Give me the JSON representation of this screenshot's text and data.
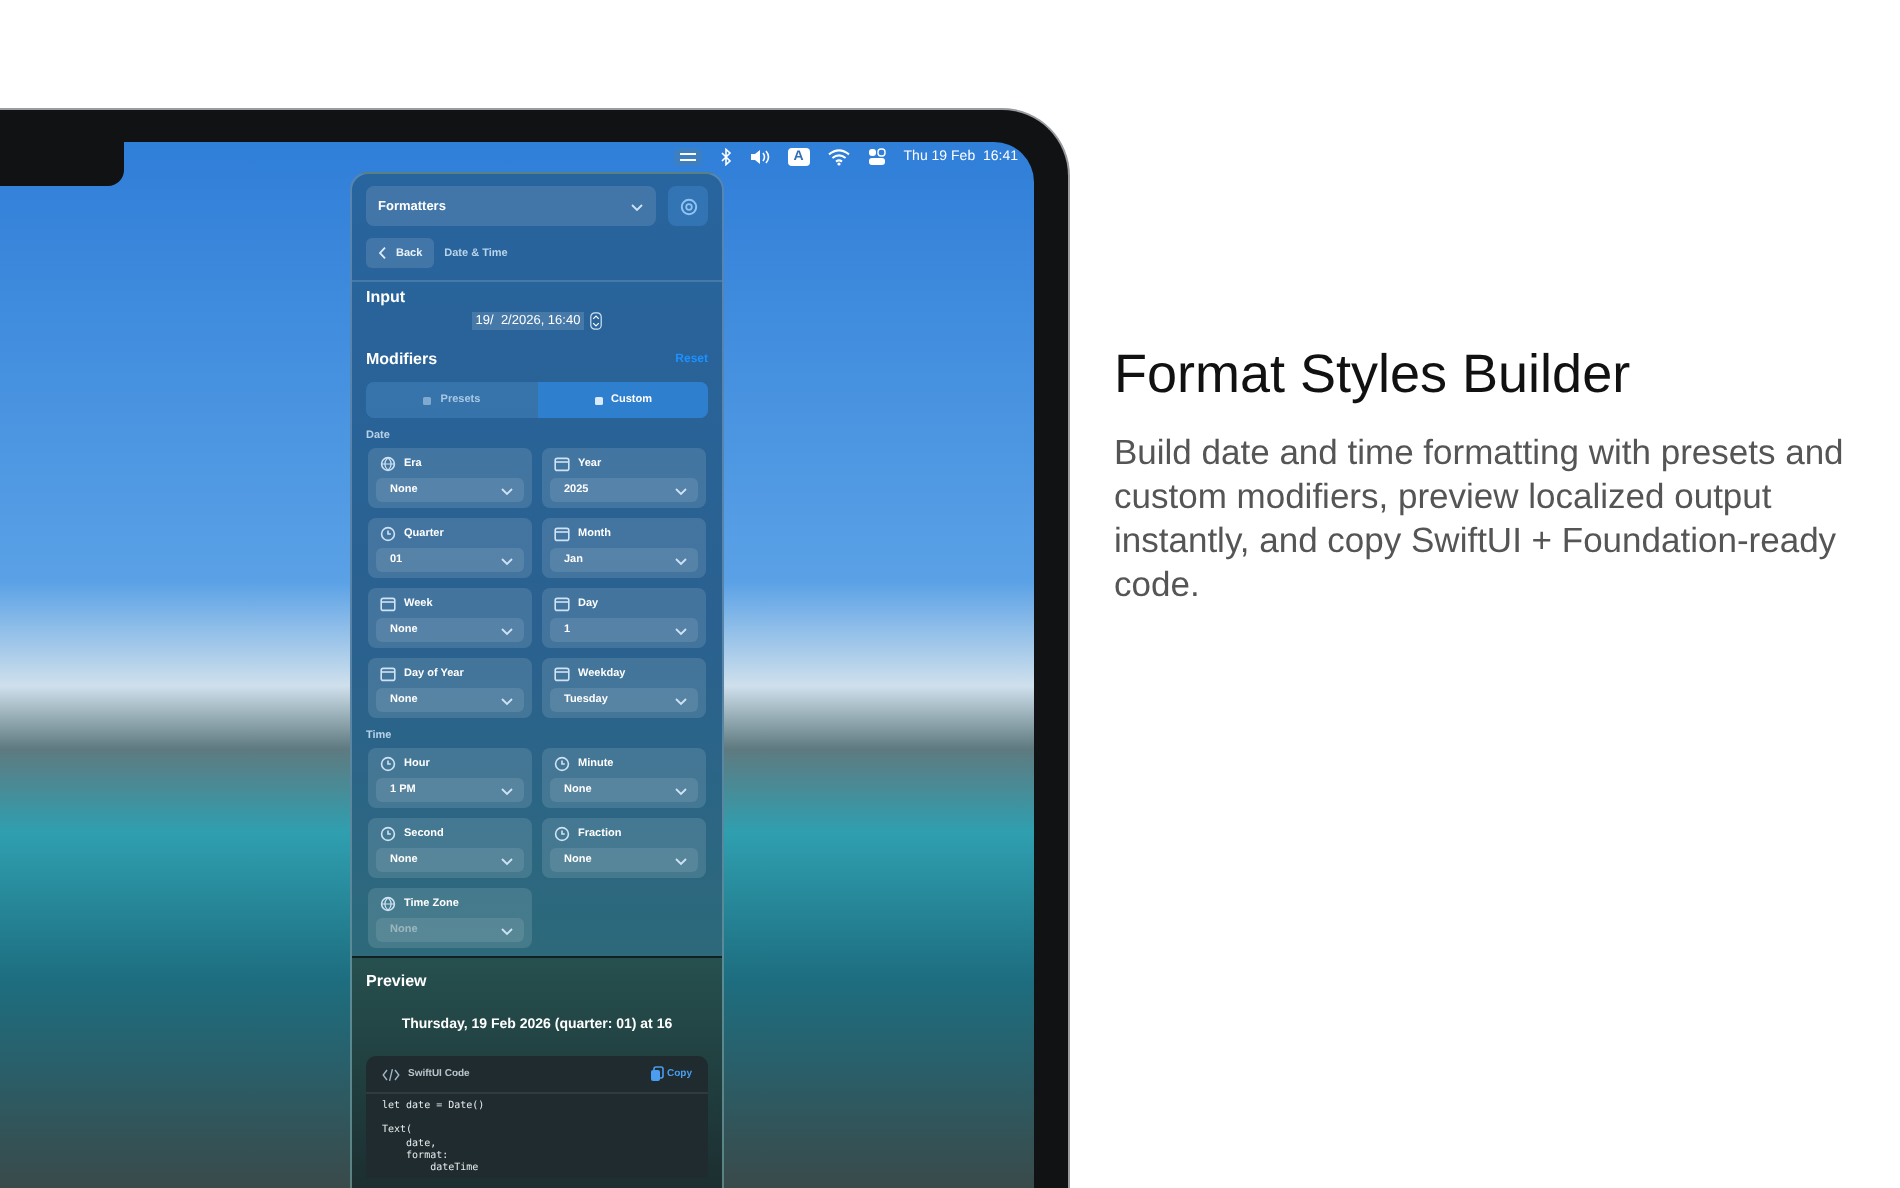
{
  "menu_bar": {
    "input_source": "A",
    "clock": "Thu 19 Feb  16:41"
  },
  "panel": {
    "picker": {
      "value": "Formatters"
    },
    "back_button": "Back",
    "breadcrumb": "Date & Time",
    "input": {
      "title": "Input",
      "value": "19/  2/2026, 16:40"
    },
    "modifiers": {
      "title": "Modifiers",
      "reset": "Reset",
      "segments": [
        {
          "label": "Presets",
          "selected": false
        },
        {
          "label": "Custom",
          "selected": true
        }
      ]
    },
    "groups": [
      {
        "title": "Date",
        "fields": [
          {
            "kind": "globe",
            "label": "Era",
            "value": "None",
            "disabled": false
          },
          {
            "kind": "calendar",
            "label": "Year",
            "value": "2025",
            "disabled": false
          },
          {
            "kind": "clock",
            "label": "Quarter",
            "value": "01",
            "disabled": false
          },
          {
            "kind": "calendar",
            "label": "Month",
            "value": "Jan",
            "disabled": false
          },
          {
            "kind": "calendar",
            "label": "Week",
            "value": "None",
            "disabled": false
          },
          {
            "kind": "calendar",
            "label": "Day",
            "value": "1",
            "disabled": false
          },
          {
            "kind": "calendar",
            "label": "Day of Year",
            "value": "None",
            "disabled": false
          },
          {
            "kind": "calendar",
            "label": "Weekday",
            "value": "Tuesday",
            "disabled": false
          }
        ]
      },
      {
        "title": "Time",
        "fields": [
          {
            "kind": "clock",
            "label": "Hour",
            "value": "1 PM",
            "disabled": false
          },
          {
            "kind": "clock",
            "label": "Minute",
            "value": "None",
            "disabled": false
          },
          {
            "kind": "clock",
            "label": "Second",
            "value": "None",
            "disabled": false
          },
          {
            "kind": "clock",
            "label": "Fraction",
            "value": "None",
            "disabled": false
          },
          {
            "kind": "globe",
            "label": "Time Zone",
            "value": "None",
            "disabled": true
          }
        ]
      }
    ],
    "preview": {
      "title": "Preview",
      "text": "Thursday, 19 Feb 2026 (quarter: 01) at 16",
      "code": {
        "title": "SwiftUI Code",
        "copy": "Copy",
        "blocks": [
          [
            "let date = Date()"
          ],
          [
            "Text(",
            "    date,",
            "    format:",
            "        dateTime"
          ]
        ]
      }
    }
  },
  "headline": {
    "title": "Format Styles Builder",
    "description": "Build date and time formatting with presets and custom modifiers, preview localized output instantly, and copy SwiftUI + Foundation-ready code."
  }
}
